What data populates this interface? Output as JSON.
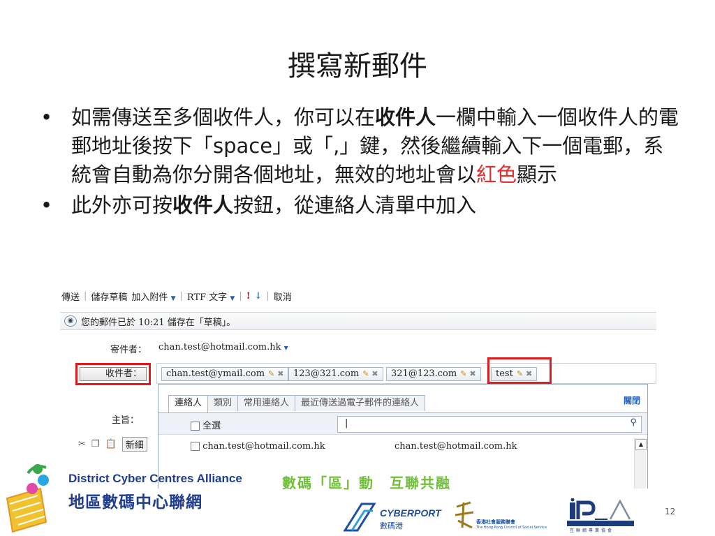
{
  "slide": {
    "title": "撰寫新郵件",
    "bullets": [
      {
        "parts": [
          {
            "text": "如需傳送至多個收件人，你可以在",
            "style": "normal"
          },
          {
            "text": "收件人",
            "style": "bold"
          },
          {
            "text": "一欄中輸入一個收件人的電郵地址後按下「space」或「,」鍵，然後繼續輸入下一個電郵，系統會自動為你分開各個地址，無效的地址會以",
            "style": "normal"
          },
          {
            "text": "紅色",
            "style": "red"
          },
          {
            "text": "顯示",
            "style": "normal"
          }
        ]
      },
      {
        "parts": [
          {
            "text": "此外亦可按",
            "style": "normal"
          },
          {
            "text": "收件人",
            "style": "bold"
          },
          {
            "text": "按鈕，從連絡人清單中加入",
            "style": "normal"
          }
        ]
      }
    ],
    "page_number": "12"
  },
  "mail": {
    "toolbar": {
      "send": "傳送",
      "save_draft": "儲存草稿",
      "attach": "加入附件",
      "rtf": "RTF 文字",
      "cancel": "取消"
    },
    "notice": "您的郵件已於 10:21 儲存在「草稿」。",
    "from_label": "寄件者：",
    "from_value": "chan.test@hotmail.com.hk",
    "to_button": "收件者：",
    "recipients": [
      "chan.test@ymail.com",
      "123@321.com",
      "321@123.com",
      "test"
    ],
    "invalid_recipient_index": 3,
    "subject_label": "主旨：",
    "new_label": "新細",
    "contacts_popup": {
      "tabs": [
        "連絡人",
        "類別",
        "常用連絡人",
        "最近傳送過電子郵件的連絡人"
      ],
      "active_tab": 0,
      "close": "關閉",
      "select_all": "全選",
      "search_value": "|",
      "contacts": [
        {
          "name": "chan.test@hotmail.com.hk",
          "email": "chan.test@hotmail.com.hk"
        }
      ]
    }
  },
  "footer": {
    "dcca_en": "District Cyber Centres Alliance",
    "dcca_zh": "地區數碼中心聯網",
    "slogan": "數碼「區」動　互聯共融",
    "cyberport_en": "CYBERPORT",
    "cyberport_zh": "數碼港",
    "hkcss_zh": "香港社會服務聯會",
    "hkcss_en": "The Hong Kong Council of Social Service",
    "ipro_zh": "互聯網專業協會"
  },
  "colors": {
    "accent_red": "#e03030",
    "highlight_box": "#e01b1b",
    "brand_blue": "#1f3d8c",
    "slogan_green": "#6fbf3a"
  }
}
